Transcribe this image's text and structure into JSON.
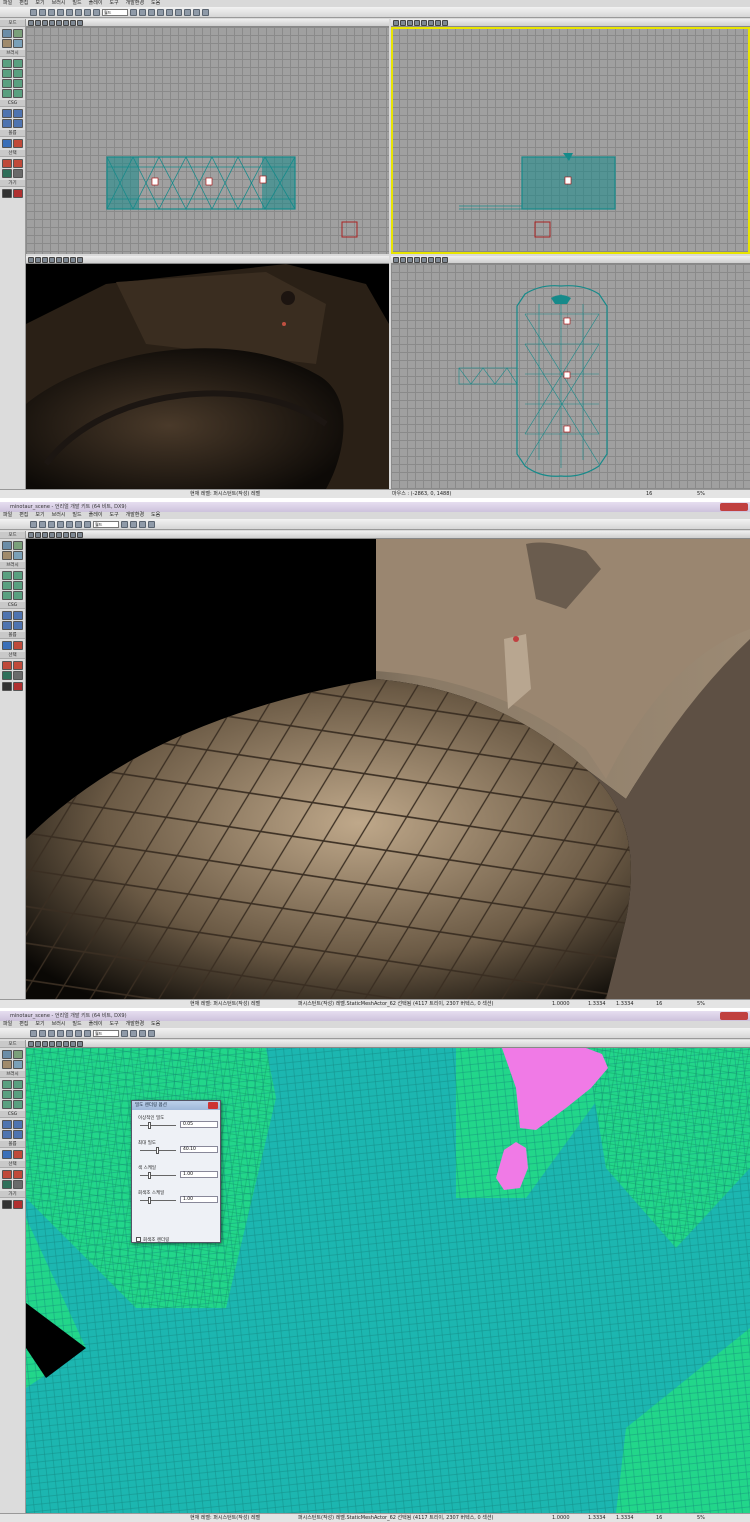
{
  "menu": [
    "파일",
    "편집",
    "보기",
    "브러시",
    "빌드",
    "플레이",
    "도구",
    "개발환경",
    "도움"
  ],
  "window_title": "minotaur_scene - 언리얼 개발 키트 (64 비트, DX9)",
  "toolbar": {
    "combo": "월드"
  },
  "left_toolbar": {
    "modes": "모드",
    "brushes": "브러시",
    "csg": "CSG",
    "volumes": "볼륨",
    "select": "선택",
    "go": "가기"
  },
  "status1": {
    "level": "현재 레벨: 퍼시스턴트(작성) 레벨",
    "mouse": "마우스 : (-2863, 0, 1488)",
    "snap": "16",
    "pct": "5%"
  },
  "status2": {
    "level": "현재 레벨: 퍼시스턴트(작성) 레벨",
    "selection": "퍼시스턴트(작성) 레벨.StaticMeshActor_62 선택됨 (4117 트리이, 2307 버텍스, 0 섹션)",
    "v1": "1.0000",
    "v2": "1.3334",
    "v3": "1.3334",
    "snap": "16",
    "pct": "5%"
  },
  "status3": {
    "level": "현재 레벨: 퍼시스턴트(작성) 레벨",
    "selection": "퍼시스턴트(작성) 레벨.StaticMeshActor_62 선택됨 (4117 트리이, 2307 버텍스, 0 섹션)",
    "v1": "1.0000",
    "v2": "1.3334",
    "v3": "1.3334",
    "snap": "16",
    "pct": "5%"
  },
  "dialog": {
    "title": "밀도 렌더링 옵션",
    "ideal_label": "이상적인 밀도",
    "ideal_value": "0.05",
    "max_label": "최대 밀도",
    "max_value": "40.10",
    "color_label": "색 스케일",
    "color_value": "1.00",
    "gray_label": "회색조 스케일",
    "gray_value": "1.00",
    "gray_check": "회색조 렌더링"
  },
  "colors": {
    "wire": "#168a8a",
    "density_teal": "#22bfb0",
    "density_green": "#22d68a",
    "density_pink": "#f07ae6"
  }
}
